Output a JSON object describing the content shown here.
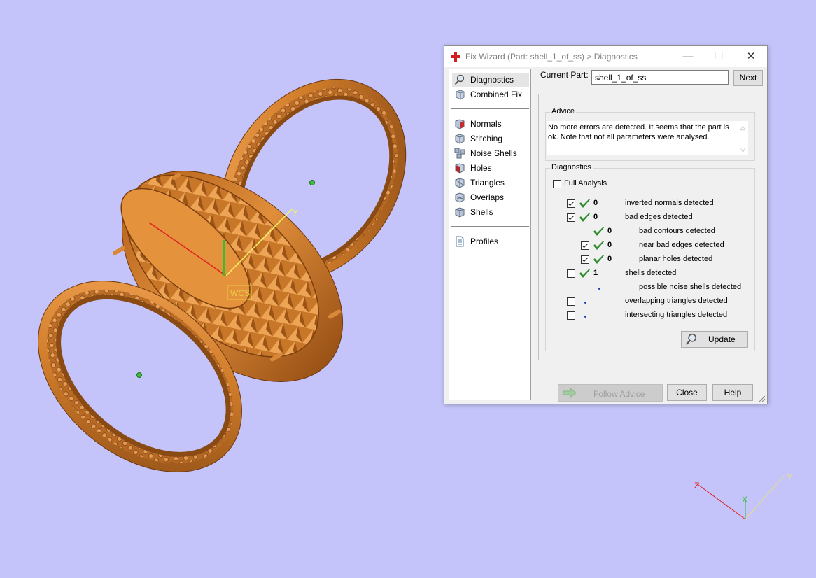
{
  "window": {
    "title": "Fix Wizard (Part: shell_1_of_ss) > Diagnostics",
    "minimize": "—",
    "maximize": "☐",
    "close": "✕"
  },
  "nav": {
    "items_top": [
      {
        "label": "Diagnostics",
        "icon": "magnifier-icon",
        "selected": true
      },
      {
        "label": "Combined Fix",
        "icon": "cube-icon"
      }
    ],
    "items_fix": [
      {
        "label": "Normals",
        "icon": "normals-cube-icon"
      },
      {
        "label": "Stitching",
        "icon": "stitching-cube-icon"
      },
      {
        "label": "Noise Shells",
        "icon": "noise-cube-icon"
      },
      {
        "label": "Holes",
        "icon": "holes-cube-icon"
      },
      {
        "label": "Triangles",
        "icon": "triangles-cube-icon"
      },
      {
        "label": "Overlaps",
        "icon": "overlaps-cube-icon"
      },
      {
        "label": "Shells",
        "icon": "shells-cube-icon"
      }
    ],
    "items_bottom": [
      {
        "label": "Profiles",
        "icon": "document-icon"
      }
    ]
  },
  "current_part": {
    "label": "Current Part:",
    "value": "shell_1_of_ss"
  },
  "buttons": {
    "next": "Next",
    "update": "Update",
    "follow_advice": "Follow Advice",
    "close": "Close",
    "help": "Help"
  },
  "advice": {
    "legend": "Advice",
    "text": "No more errors are detected. It seems that the part is ok. Note that not all parameters were analysed."
  },
  "diagnostics": {
    "legend": "Diagnostics",
    "full_analysis": "Full Analysis",
    "rows": [
      {
        "label": "inverted normals detected",
        "count": "0",
        "checkbox": true,
        "checked": true,
        "status": "ok",
        "indent": 0
      },
      {
        "label": "bad edges detected",
        "count": "0",
        "checkbox": true,
        "checked": true,
        "status": "ok",
        "indent": 0
      },
      {
        "label": "bad contours detected",
        "count": "0",
        "checkbox": false,
        "checked": false,
        "status": "ok",
        "indent": 1
      },
      {
        "label": "near bad edges detected",
        "count": "0",
        "checkbox": true,
        "checked": true,
        "status": "ok",
        "indent": 1
      },
      {
        "label": "planar holes detected",
        "count": "0",
        "checkbox": true,
        "checked": true,
        "status": "ok",
        "indent": 1
      },
      {
        "label": "shells detected",
        "count": "1",
        "checkbox": true,
        "checked": false,
        "status": "ok",
        "indent": 0
      },
      {
        "label": "possible noise shells detected",
        "count": "",
        "checkbox": false,
        "checked": false,
        "status": "dot",
        "indent": 1
      },
      {
        "label": "overlapping triangles detected",
        "count": "",
        "checkbox": true,
        "checked": false,
        "status": "dot",
        "indent": 0
      },
      {
        "label": "intersecting triangles detected",
        "count": "",
        "checkbox": true,
        "checked": false,
        "status": "dot",
        "indent": 0
      }
    ]
  },
  "viewport": {
    "wcs_label": "WCS",
    "ucs_axis_label": "y",
    "axis_labels": {
      "z": "Z",
      "x": "X",
      "y": "Y"
    },
    "colors": {
      "background": "#c4c4fb",
      "ring": "#cf7c2a",
      "ring_dark": "#8a4a14",
      "ring_light": "#f0a050",
      "x_axis": "#e02020",
      "y_axis": "#f0f050",
      "z_axis": "#30c030"
    }
  }
}
